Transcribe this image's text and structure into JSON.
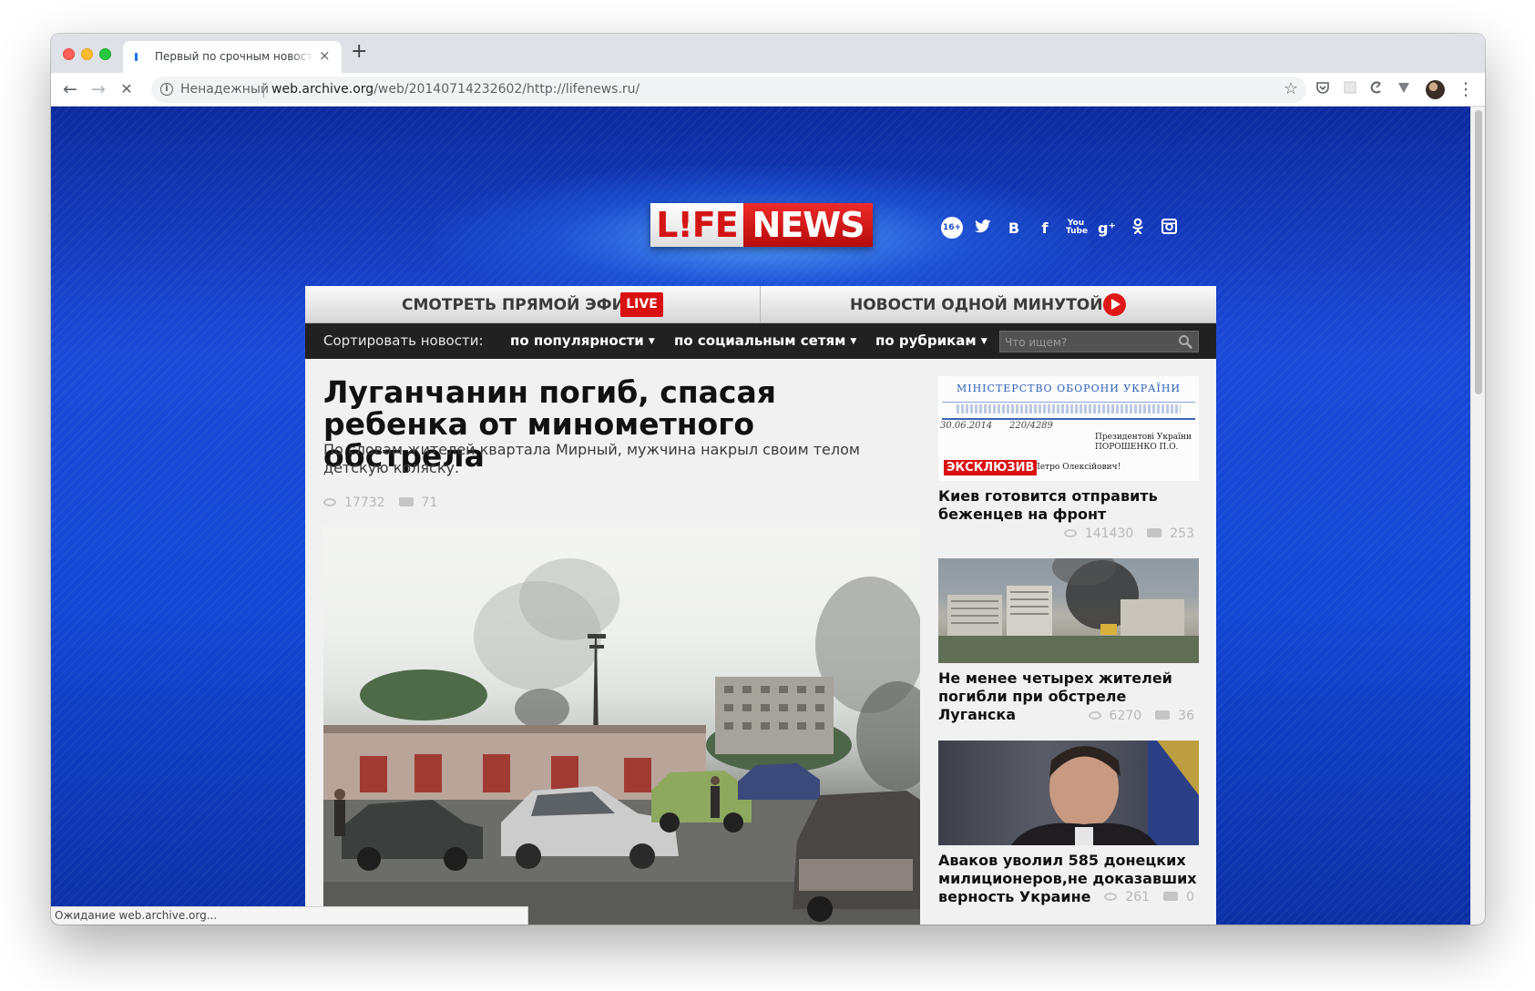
{
  "browser": {
    "tab_title": "Первый по срочным новостям",
    "tab_close": "×",
    "new_tab": "+",
    "back": "←",
    "forward": "→",
    "reload": "✕",
    "insecure_label": "Ненадежный",
    "url_host": "web.archive.org",
    "url_path": "/web/20140714232602/http://lifenews.ru/",
    "star": "☆",
    "menu": "⋮",
    "status_text": "Ожидание web.archive.org..."
  },
  "site": {
    "logo_life": "L!FE",
    "logo_news": "NEWS",
    "age_rating": "16+",
    "social": [
      {
        "icon": "twitter-icon",
        "glyph": "🐦"
      },
      {
        "icon": "vk-icon",
        "glyph": "B"
      },
      {
        "icon": "facebook-icon",
        "glyph": "f"
      },
      {
        "icon": "youtube-icon",
        "glyph": "You"
      },
      {
        "icon": "google-plus-icon",
        "glyph": "g+"
      },
      {
        "icon": "odnoklassniki-icon",
        "glyph": "ok"
      },
      {
        "icon": "instagram-icon",
        "glyph": "◙"
      }
    ],
    "watch_live_label": "СМОТРЕТЬ ПРЯМОЙ ЭФИР",
    "live_badge": "LIVE",
    "one_minute_label": "НОВОСТИ ОДНОЙ МИНУТОЙ",
    "sort_label": "Сортировать новости:",
    "sort_popular": "по популярности",
    "sort_social": "по социальным сетям",
    "sort_rubric": "по рубрикам",
    "search_placeholder": "Что ищем?",
    "colors": {
      "live_red": "#d91111",
      "background_blue": "#1247d6",
      "sortbar": "#212121"
    }
  },
  "main_article": {
    "title": "Луганчанин погиб, спасая ребенка от минометного обстрела",
    "lead": "По словам жителей квартала Мирный, мужчина накрыл своим телом детскую коляску.",
    "views": "17732",
    "comments": "71"
  },
  "side_articles": [
    {
      "title": "Киев готовится отправить беженцев на фронт",
      "views": "141430",
      "comments": "253",
      "badge": "ЭКСКЛЮЗИВ",
      "doc_header": "МІНІСТЕРСТВО ОБОРОНИ УКРАЇНИ",
      "doc_addressee": "Президентові України ПОРОШЕНКО П.О.",
      "doc_greeting": "Петро Олексійович!",
      "doc_date": "30.06.2014",
      "doc_number": "220/4289"
    },
    {
      "title": "Не менее четырех жителей погибли при обстреле Луганска",
      "views": "6270",
      "comments": "36"
    },
    {
      "title": "Аваков уволил 585 донецких милиционеров,не доказавших верность Украине",
      "views": "261",
      "comments": "0"
    }
  ]
}
